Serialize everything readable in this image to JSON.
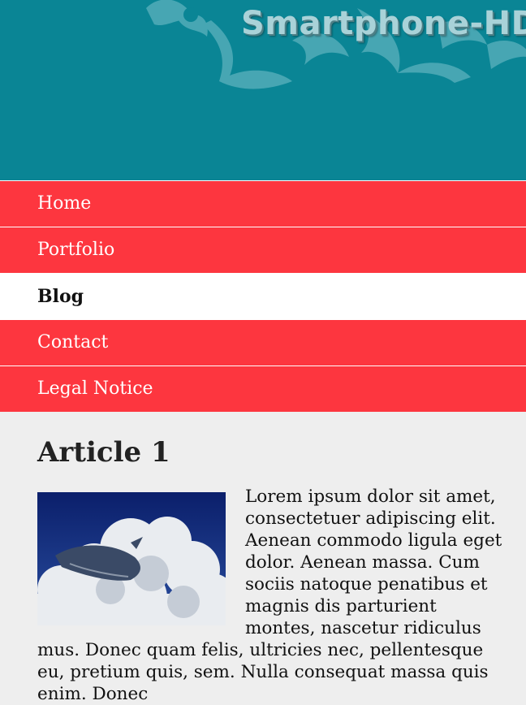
{
  "header": {
    "site_title": "Smartphone-HD",
    "background_color": "#0a8595"
  },
  "nav": {
    "items": [
      {
        "label": "Home"
      },
      {
        "label": "Portfolio"
      },
      {
        "label": "Blog",
        "active": true
      },
      {
        "label": "Contact"
      },
      {
        "label": "Legal Notice"
      }
    ],
    "color": "#fd363f"
  },
  "article": {
    "title": "Article 1",
    "body": "Lorem ipsum dolor sit amet, consectetuer adipiscing elit. Aenean commodo ligula eget dolor. Aenean massa. Cum sociis natoque penatibus et magnis dis parturient montes, nascetur ridiculus mus. Donec quam felis, ultricies nec, pellentesque eu, pretium quis, sem. Nulla consequat massa quis enim. Donec"
  }
}
